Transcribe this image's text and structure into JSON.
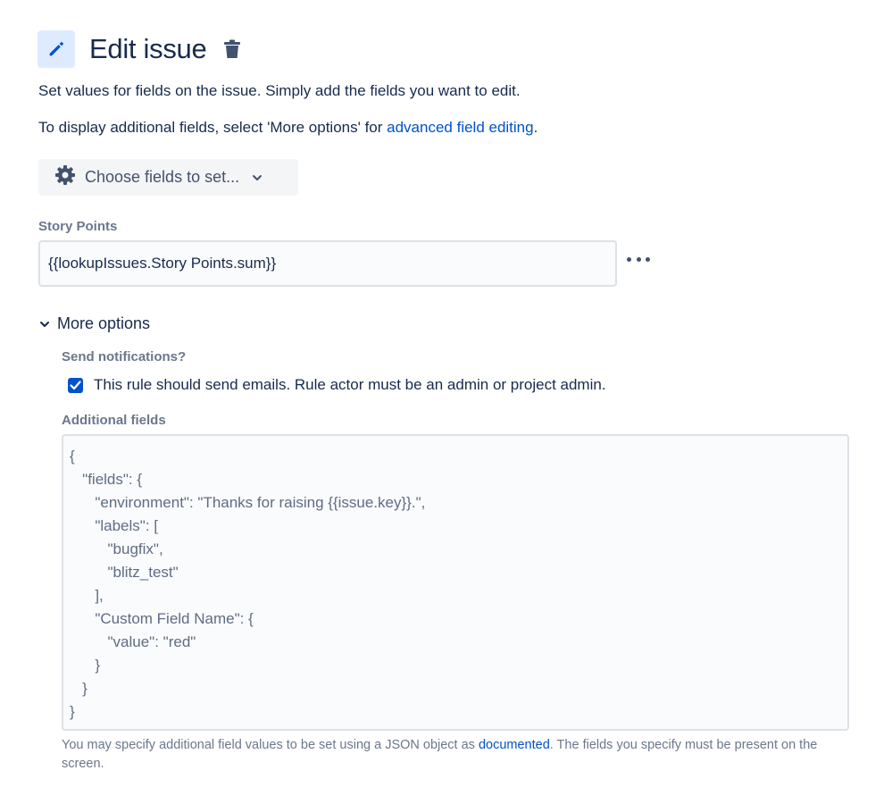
{
  "header": {
    "title": "Edit issue",
    "edit_icon": "pencil-icon",
    "delete_icon": "trash-icon"
  },
  "description": {
    "line1": "Set values for fields on the issue. Simply add the fields you want to edit.",
    "line2_prefix": "To display additional fields, select 'More options' for ",
    "line2_link": "advanced field editing",
    "line2_suffix": "."
  },
  "choose_fields": {
    "label": "Choose fields to set...",
    "icon": "gear-icon",
    "chevron": "chevron-down-icon"
  },
  "story_points": {
    "label": "Story Points",
    "value": "{{lookupIssues.Story Points.sum}}",
    "more_icon": "more-horizontal-icon"
  },
  "more_options": {
    "label": "More options",
    "expanded": true,
    "send_notifications": {
      "label": "Send notifications?",
      "checkbox_label": "This rule should send emails. Rule actor must be an admin or project admin.",
      "checked": true
    },
    "additional_fields": {
      "label": "Additional fields",
      "value": "{\n   \"fields\": {\n      \"environment\": \"Thanks for raising {{issue.key}}.\",\n      \"labels\": [\n         \"bugfix\",\n         \"blitz_test\"\n      ],\n      \"Custom Field Name\": {\n         \"value\": \"red\"\n      }\n   }\n}",
      "help_prefix": "You may specify additional field values to be set using a JSON object as ",
      "help_link": "documented",
      "help_suffix": ". The fields you specify must be present on the screen."
    }
  },
  "colors": {
    "accent": "#0052cc",
    "text": "#172b4d",
    "muted": "#6b778c",
    "icon_bg": "#deebff"
  }
}
